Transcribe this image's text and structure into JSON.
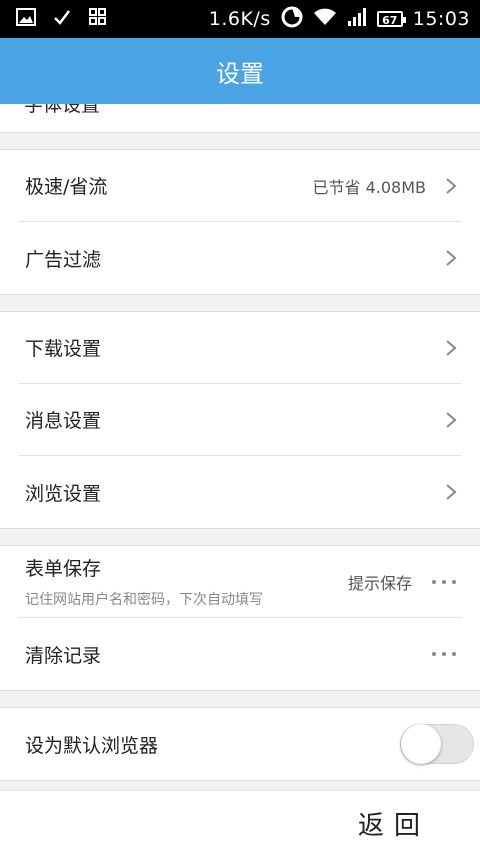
{
  "statusbar": {
    "speed": "1.6K/s",
    "battery": "67",
    "time": "15:03",
    "icons": [
      "image-icon",
      "check-icon",
      "apps-icon",
      "sync-icon",
      "wifi-icon",
      "signal-icon",
      "battery-icon"
    ]
  },
  "header": {
    "title": "设置"
  },
  "cut_item": {
    "label": "字体设置"
  },
  "groups": {
    "g1": {
      "speed": {
        "label": "极速/省流",
        "value": "已节省 4.08MB"
      },
      "adblock": {
        "label": "广告过滤"
      }
    },
    "g2": {
      "download": {
        "label": "下载设置"
      },
      "message": {
        "label": "消息设置"
      },
      "browse": {
        "label": "浏览设置"
      }
    },
    "g3": {
      "form": {
        "label": "表单保存",
        "sub": "记住网站用户名和密码，下次自动填写",
        "value": "提示保存"
      },
      "clear": {
        "label": "清除记录"
      }
    },
    "g4": {
      "default": {
        "label": "设为默认浏览器",
        "enabled": false
      }
    }
  },
  "footer": {
    "back_label": "返回"
  },
  "colors": {
    "header_bg": "#4aa3e2",
    "statusbar_bg": "#000000",
    "page_bg": "#f2f2f2"
  }
}
